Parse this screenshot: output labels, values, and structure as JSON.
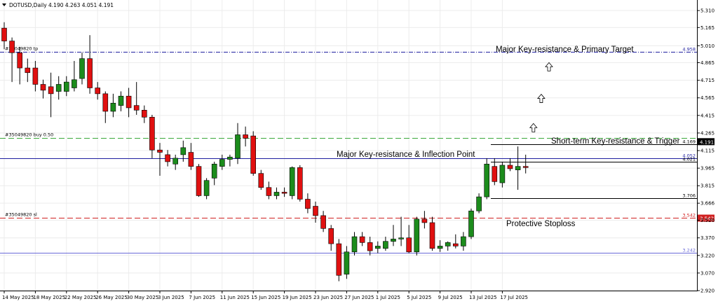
{
  "header": {
    "symbol_line": "DOTUSD,Daily  4.190 4.263 4.051 4.191"
  },
  "chart_data": {
    "type": "candlestick",
    "symbol": "DOTUSD",
    "timeframe": "Daily",
    "ohlc_header": {
      "open": 4.19,
      "high": 4.263,
      "low": 4.051,
      "close": 4.191
    },
    "ylim": [
      2.92,
      5.4
    ],
    "y_ticks": [
      "5.310",
      "5.165",
      "5.010",
      "4.865",
      "4.715",
      "4.565",
      "4.415",
      "4.265",
      "4.115",
      "3.965",
      "3.815",
      "3.666",
      "3.520",
      "3.370",
      "3.220",
      "3.070",
      "2.920"
    ],
    "x_ticks": [
      {
        "index": 0,
        "label": "14 May 2025"
      },
      {
        "index": 4,
        "label": "18 May 2025"
      },
      {
        "index": 8,
        "label": "22 May 2025"
      },
      {
        "index": 12,
        "label": "26 May 2025"
      },
      {
        "index": 16,
        "label": "30 May 2025"
      },
      {
        "index": 20,
        "label": "3 Jun 2025"
      },
      {
        "index": 24,
        "label": "7 Jun 2025"
      },
      {
        "index": 28,
        "label": "11 Jun 2025"
      },
      {
        "index": 32,
        "label": "15 Jun 2025"
      },
      {
        "index": 36,
        "label": "19 Jun 2025"
      },
      {
        "index": 40,
        "label": "23 Jun 2025"
      },
      {
        "index": 44,
        "label": "27 Jun 2025"
      },
      {
        "index": 48,
        "label": "1 Jul 2025"
      },
      {
        "index": 52,
        "label": "5 Jul 2025"
      },
      {
        "index": 56,
        "label": "9 Jul 2025"
      },
      {
        "index": 60,
        "label": "13 Jul 2025"
      },
      {
        "index": 64,
        "label": "17 Jul 2025"
      }
    ],
    "candles": [
      {
        "o": 5.16,
        "h": 5.21,
        "l": 4.98,
        "c": 5.05
      },
      {
        "o": 5.05,
        "h": 5.08,
        "l": 4.7,
        "c": 4.95
      },
      {
        "o": 4.95,
        "h": 5.0,
        "l": 4.68,
        "c": 4.82
      },
      {
        "o": 4.82,
        "h": 4.9,
        "l": 4.7,
        "c": 4.78
      },
      {
        "o": 4.82,
        "h": 4.88,
        "l": 4.62,
        "c": 4.68
      },
      {
        "o": 4.68,
        "h": 4.72,
        "l": 4.56,
        "c": 4.63
      },
      {
        "o": 4.66,
        "h": 4.78,
        "l": 4.4,
        "c": 4.6
      },
      {
        "o": 4.62,
        "h": 4.75,
        "l": 4.55,
        "c": 4.68
      },
      {
        "o": 4.62,
        "h": 4.75,
        "l": 4.58,
        "c": 4.7
      },
      {
        "o": 4.65,
        "h": 4.88,
        "l": 4.62,
        "c": 4.72
      },
      {
        "o": 4.73,
        "h": 4.95,
        "l": 4.68,
        "c": 4.9
      },
      {
        "o": 4.9,
        "h": 5.1,
        "l": 4.6,
        "c": 4.65
      },
      {
        "o": 4.65,
        "h": 4.7,
        "l": 4.55,
        "c": 4.6
      },
      {
        "o": 4.6,
        "h": 4.62,
        "l": 4.35,
        "c": 4.45
      },
      {
        "o": 4.45,
        "h": 4.6,
        "l": 4.4,
        "c": 4.52
      },
      {
        "o": 4.5,
        "h": 4.62,
        "l": 4.45,
        "c": 4.58
      },
      {
        "o": 4.58,
        "h": 4.65,
        "l": 4.4,
        "c": 4.48
      },
      {
        "o": 4.5,
        "h": 4.7,
        "l": 4.42,
        "c": 4.46
      },
      {
        "o": 4.46,
        "h": 4.5,
        "l": 4.35,
        "c": 4.4
      },
      {
        "o": 4.4,
        "h": 4.42,
        "l": 4.05,
        "c": 4.12
      },
      {
        "o": 4.12,
        "h": 4.18,
        "l": 3.9,
        "c": 4.1
      },
      {
        "o": 4.08,
        "h": 4.12,
        "l": 3.98,
        "c": 4.02
      },
      {
        "o": 4.0,
        "h": 4.08,
        "l": 3.95,
        "c": 4.05
      },
      {
        "o": 4.08,
        "h": 4.2,
        "l": 4.02,
        "c": 4.14
      },
      {
        "o": 4.1,
        "h": 4.18,
        "l": 3.95,
        "c": 3.98
      },
      {
        "o": 3.98,
        "h": 4.0,
        "l": 3.72,
        "c": 3.73
      },
      {
        "o": 3.73,
        "h": 3.88,
        "l": 3.7,
        "c": 3.86
      },
      {
        "o": 3.88,
        "h": 4.02,
        "l": 3.82,
        "c": 4.0
      },
      {
        "o": 3.98,
        "h": 4.08,
        "l": 3.95,
        "c": 4.04
      },
      {
        "o": 4.04,
        "h": 4.08,
        "l": 3.98,
        "c": 4.06
      },
      {
        "o": 4.05,
        "h": 4.35,
        "l": 4.0,
        "c": 4.25
      },
      {
        "o": 4.25,
        "h": 4.32,
        "l": 4.15,
        "c": 4.22
      },
      {
        "o": 4.24,
        "h": 4.28,
        "l": 3.9,
        "c": 3.92
      },
      {
        "o": 3.92,
        "h": 3.95,
        "l": 3.78,
        "c": 3.8
      },
      {
        "o": 3.8,
        "h": 3.85,
        "l": 3.7,
        "c": 3.73
      },
      {
        "o": 3.73,
        "h": 3.8,
        "l": 3.7,
        "c": 3.76
      },
      {
        "o": 3.76,
        "h": 3.8,
        "l": 3.72,
        "c": 3.75
      },
      {
        "o": 3.73,
        "h": 3.98,
        "l": 3.7,
        "c": 3.97
      },
      {
        "o": 3.97,
        "h": 3.99,
        "l": 3.68,
        "c": 3.7
      },
      {
        "o": 3.7,
        "h": 3.75,
        "l": 3.58,
        "c": 3.62
      },
      {
        "o": 3.64,
        "h": 3.68,
        "l": 3.5,
        "c": 3.56
      },
      {
        "o": 3.56,
        "h": 3.6,
        "l": 3.42,
        "c": 3.45
      },
      {
        "o": 3.45,
        "h": 3.48,
        "l": 3.26,
        "c": 3.32
      },
      {
        "o": 3.32,
        "h": 3.36,
        "l": 3.0,
        "c": 3.05
      },
      {
        "o": 3.06,
        "h": 3.3,
        "l": 3.02,
        "c": 3.25
      },
      {
        "o": 3.25,
        "h": 3.42,
        "l": 3.22,
        "c": 3.38
      },
      {
        "o": 3.38,
        "h": 3.42,
        "l": 3.3,
        "c": 3.33
      },
      {
        "o": 3.33,
        "h": 3.38,
        "l": 3.22,
        "c": 3.26
      },
      {
        "o": 3.28,
        "h": 3.34,
        "l": 3.24,
        "c": 3.3
      },
      {
        "o": 3.28,
        "h": 3.38,
        "l": 3.26,
        "c": 3.34
      },
      {
        "o": 3.34,
        "h": 3.48,
        "l": 3.3,
        "c": 3.36
      },
      {
        "o": 3.36,
        "h": 3.55,
        "l": 3.3,
        "c": 3.37
      },
      {
        "o": 3.37,
        "h": 3.48,
        "l": 3.24,
        "c": 3.25
      },
      {
        "o": 3.25,
        "h": 3.55,
        "l": 3.22,
        "c": 3.53
      },
      {
        "o": 3.53,
        "h": 3.6,
        "l": 3.45,
        "c": 3.5
      },
      {
        "o": 3.5,
        "h": 3.55,
        "l": 3.26,
        "c": 3.28
      },
      {
        "o": 3.28,
        "h": 3.35,
        "l": 3.25,
        "c": 3.3
      },
      {
        "o": 3.3,
        "h": 3.34,
        "l": 3.26,
        "c": 3.33
      },
      {
        "o": 3.32,
        "h": 3.4,
        "l": 3.28,
        "c": 3.3
      },
      {
        "o": 3.3,
        "h": 3.42,
        "l": 3.26,
        "c": 3.38
      },
      {
        "o": 3.38,
        "h": 3.62,
        "l": 3.36,
        "c": 3.6
      },
      {
        "o": 3.6,
        "h": 3.75,
        "l": 3.58,
        "c": 3.72
      },
      {
        "o": 3.72,
        "h": 4.05,
        "l": 3.7,
        "c": 4.0
      },
      {
        "o": 3.98,
        "h": 4.05,
        "l": 3.82,
        "c": 3.85
      },
      {
        "o": 3.84,
        "h": 4.02,
        "l": 3.8,
        "c": 3.99
      },
      {
        "o": 3.99,
        "h": 4.05,
        "l": 3.94,
        "c": 3.96
      },
      {
        "o": 3.95,
        "h": 4.15,
        "l": 3.78,
        "c": 3.98
      },
      {
        "o": 3.98,
        "h": 4.08,
        "l": 3.92,
        "c": 3.97
      }
    ],
    "levels": [
      {
        "name": "Major Key-resistance & Primary Target",
        "value": 4.958,
        "price_label": "4.958",
        "order_label": "#35049820 tp",
        "color": "#1f1f9f",
        "style": "dashdot"
      },
      {
        "name": "Short-term Key-resistance & Trigger",
        "value": 4.169,
        "price_label": "4.169",
        "order_label": "",
        "color": "#000000",
        "style": "solid"
      },
      {
        "name": "Major Key-resistance & Inflection Point",
        "value": 4.052,
        "price_label": "4.052",
        "order_label": "",
        "color": "#1f1f9f",
        "style": "solid"
      },
      {
        "name": "",
        "value": 4.021,
        "price_label": "4.021",
        "order_label": "",
        "color": "#000000",
        "style": "solid"
      },
      {
        "name": "",
        "value": 3.706,
        "price_label": "3.706",
        "order_label": "",
        "color": "#000000",
        "style": "solid"
      },
      {
        "name": "Protective Stoploss",
        "value": 3.542,
        "price_label": "3.542",
        "order_label": "#35049820 sl",
        "color": "#d02020",
        "style": "dashed"
      },
      {
        "name": "",
        "value": 3.242,
        "price_label": "3.242",
        "order_label": "",
        "color": "#6a6ad8",
        "style": "solid"
      },
      {
        "name": "",
        "value": 4.22,
        "price_label": "",
        "order_label": "#35049820 buy 0.50",
        "color": "#3aa83a",
        "style": "dashed"
      }
    ],
    "current_price": "4.191",
    "colors": {
      "bull": "#1c8c1c",
      "bear": "#e01010",
      "grid": "#ececec"
    },
    "arrows": [
      {
        "index": 68,
        "value": 4.31
      },
      {
        "index": 69,
        "value": 4.56
      },
      {
        "index": 70,
        "value": 4.83
      }
    ]
  },
  "annotations": {
    "primary_target": "Major Key-resistance & Primary Target",
    "trigger": "Short-term Key-resistance & Trigger",
    "inflection": "Major Key-resistance & Inflection Point",
    "stoploss": "Protective Stoploss"
  }
}
